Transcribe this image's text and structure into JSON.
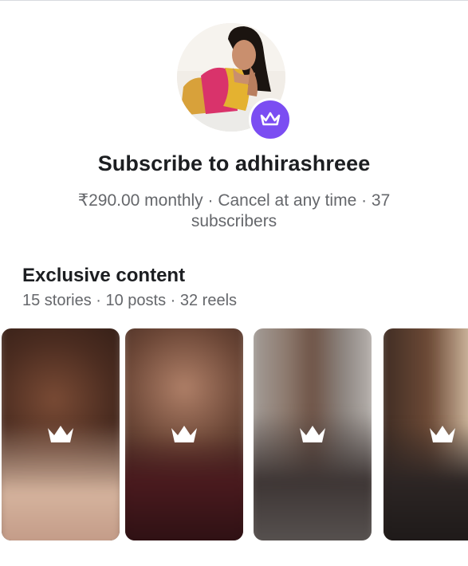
{
  "subscription": {
    "title": "Subscribe to adhirashreee",
    "subtitle": "₹290.00 monthly · Cancel at any time · 37 subscribers",
    "avatar_icon": "profile-photo",
    "badge_icon": "crown-icon",
    "badge_color": "#7b4df2"
  },
  "exclusive": {
    "title": "Exclusive content",
    "stats": "15 stories · 10 posts · 32 reels",
    "tiles": [
      {
        "name": "locked-content-1",
        "icon": "crown-icon"
      },
      {
        "name": "locked-content-2",
        "icon": "crown-icon"
      },
      {
        "name": "locked-content-3",
        "icon": "crown-icon"
      },
      {
        "name": "locked-content-4",
        "icon": "crown-icon"
      }
    ]
  }
}
